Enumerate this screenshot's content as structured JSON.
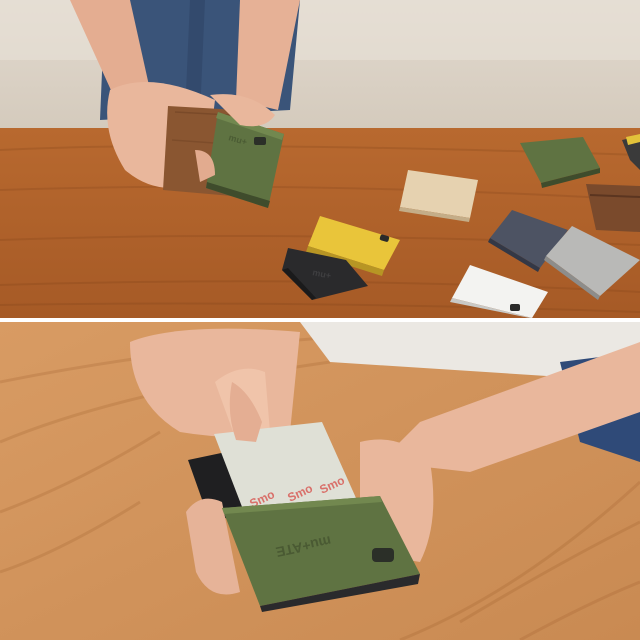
{
  "photo": {
    "panels": [
      {
        "label": "top-scene",
        "description_shown": false
      },
      {
        "label": "bottom-scene",
        "description_shown": false
      }
    ],
    "logo_text": "mu+ATE",
    "card_text": "Smo",
    "colors": {
      "wood_table_top": "#b0662e",
      "wood_table_bottom": "#d2935c",
      "sofa": "#d8cfc2",
      "jeans": "#3a5479",
      "skin": "#e9b79c",
      "olive": "#5f7342",
      "yellow": "#e9c53a",
      "black_case": "#2a2a2c",
      "beige": "#e6d2b0",
      "navy_felt": "#4d5363",
      "grey_felt": "#b9b9b7",
      "white_case": "#f3f3f1",
      "walnut": "#7a4a2c",
      "card": "#dfe0d6",
      "card_print": "#d9706a"
    }
  }
}
